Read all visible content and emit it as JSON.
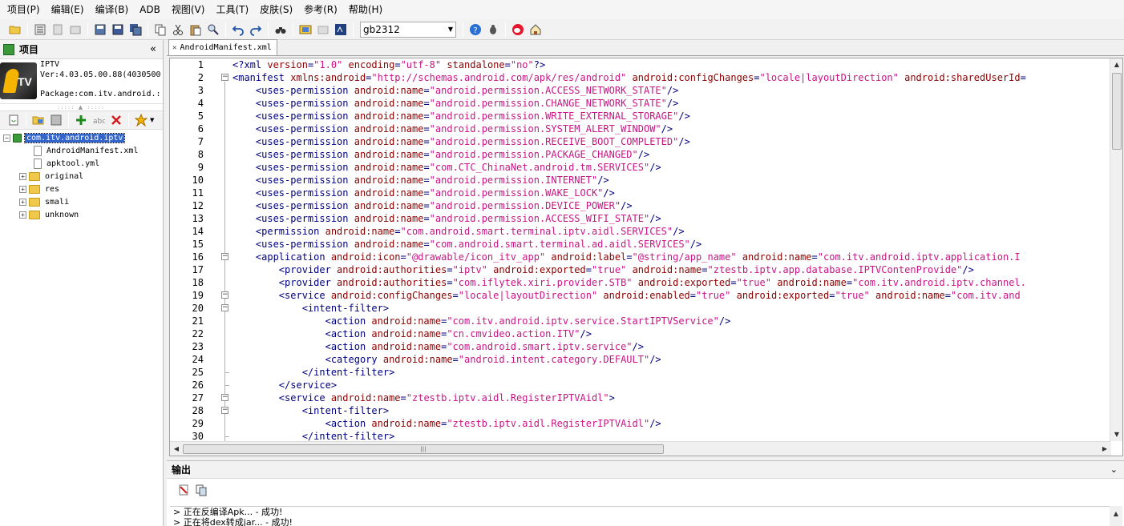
{
  "menu": [
    "项目(P)",
    "编辑(E)",
    "编译(B)",
    "ADB",
    "视图(V)",
    "工具(T)",
    "皮肤(S)",
    "参考(R)",
    "帮助(H)"
  ],
  "toolbar": {
    "encoding_value": "gb2312"
  },
  "project_panel": {
    "title": "项目",
    "collapse_glyph": "«",
    "app_name": "IPTV",
    "app_version": "Ver:4.03.05.00.88(4030500",
    "app_package": "Package:com.itv.android.:"
  },
  "tree": {
    "root": "com.itv.android.iptv",
    "files": [
      "AndroidManifest.xml",
      "apktool.yml"
    ],
    "folders": [
      "original",
      "res",
      "smali",
      "unknown"
    ]
  },
  "editor": {
    "tab_label": "AndroidManifest.xml",
    "line_numbers": [
      "1",
      "2",
      "3",
      "4",
      "5",
      "6",
      "7",
      "8",
      "9",
      "10",
      "11",
      "12",
      "13",
      "14",
      "15",
      "16",
      "17",
      "18",
      "19",
      "20",
      "21",
      "22",
      "23",
      "24",
      "25",
      "26",
      "27",
      "28",
      "29",
      "30"
    ],
    "lines": [
      [
        {
          "c": "p",
          "s": "<?xml "
        },
        {
          "c": "a",
          "s": "version"
        },
        {
          "c": "p",
          "s": "="
        },
        {
          "c": "v",
          "s": "\"1.0\""
        },
        {
          "c": "p",
          "s": " "
        },
        {
          "c": "a",
          "s": "encoding"
        },
        {
          "c": "p",
          "s": "="
        },
        {
          "c": "v",
          "s": "\"utf-8\""
        },
        {
          "c": "p",
          "s": " "
        },
        {
          "c": "a",
          "s": "standalone"
        },
        {
          "c": "p",
          "s": "="
        },
        {
          "c": "v",
          "s": "\"no\""
        },
        {
          "c": "p",
          "s": "?>"
        }
      ],
      [
        {
          "c": "t",
          "s": "<manifest "
        },
        {
          "c": "a",
          "s": "xmlns:android"
        },
        {
          "c": "p",
          "s": "="
        },
        {
          "c": "v",
          "s": "\"http://schemas.android.com/apk/res/android\""
        },
        {
          "c": "p",
          "s": " "
        },
        {
          "c": "a",
          "s": "android:configChanges"
        },
        {
          "c": "p",
          "s": "="
        },
        {
          "c": "v",
          "s": "\"locale|layoutDirection\""
        },
        {
          "c": "p",
          "s": " "
        },
        {
          "c": "a",
          "s": "android:sharedUserId"
        },
        {
          "c": "p",
          "s": "="
        }
      ],
      [
        {
          "c": "p",
          "s": "    "
        },
        {
          "c": "t",
          "s": "<uses-permission "
        },
        {
          "c": "a",
          "s": "android:name"
        },
        {
          "c": "p",
          "s": "="
        },
        {
          "c": "v",
          "s": "\"android.permission.ACCESS_NETWORK_STATE\""
        },
        {
          "c": "t",
          "s": "/>"
        }
      ],
      [
        {
          "c": "p",
          "s": "    "
        },
        {
          "c": "t",
          "s": "<uses-permission "
        },
        {
          "c": "a",
          "s": "android:name"
        },
        {
          "c": "p",
          "s": "="
        },
        {
          "c": "v",
          "s": "\"android.permission.CHANGE_NETWORK_STATE\""
        },
        {
          "c": "t",
          "s": "/>"
        }
      ],
      [
        {
          "c": "p",
          "s": "    "
        },
        {
          "c": "t",
          "s": "<uses-permission "
        },
        {
          "c": "a",
          "s": "android:name"
        },
        {
          "c": "p",
          "s": "="
        },
        {
          "c": "v",
          "s": "\"android.permission.WRITE_EXTERNAL_STORAGE\""
        },
        {
          "c": "t",
          "s": "/>"
        }
      ],
      [
        {
          "c": "p",
          "s": "    "
        },
        {
          "c": "t",
          "s": "<uses-permission "
        },
        {
          "c": "a",
          "s": "android:name"
        },
        {
          "c": "p",
          "s": "="
        },
        {
          "c": "v",
          "s": "\"android.permission.SYSTEM_ALERT_WINDOW\""
        },
        {
          "c": "t",
          "s": "/>"
        }
      ],
      [
        {
          "c": "p",
          "s": "    "
        },
        {
          "c": "t",
          "s": "<uses-permission "
        },
        {
          "c": "a",
          "s": "android:name"
        },
        {
          "c": "p",
          "s": "="
        },
        {
          "c": "v",
          "s": "\"android.permission.RECEIVE_BOOT_COMPLETED\""
        },
        {
          "c": "t",
          "s": "/>"
        }
      ],
      [
        {
          "c": "p",
          "s": "    "
        },
        {
          "c": "t",
          "s": "<uses-permission "
        },
        {
          "c": "a",
          "s": "android:name"
        },
        {
          "c": "p",
          "s": "="
        },
        {
          "c": "v",
          "s": "\"android.permission.PACKAGE_CHANGED\""
        },
        {
          "c": "t",
          "s": "/>"
        }
      ],
      [
        {
          "c": "p",
          "s": "    "
        },
        {
          "c": "t",
          "s": "<uses-permission "
        },
        {
          "c": "a",
          "s": "android:name"
        },
        {
          "c": "p",
          "s": "="
        },
        {
          "c": "v",
          "s": "\"com.CTC_ChinaNet.android.tm.SERVICES\""
        },
        {
          "c": "t",
          "s": "/>"
        }
      ],
      [
        {
          "c": "p",
          "s": "    "
        },
        {
          "c": "t",
          "s": "<uses-permission "
        },
        {
          "c": "a",
          "s": "android:name"
        },
        {
          "c": "p",
          "s": "="
        },
        {
          "c": "v",
          "s": "\"android.permission.INTERNET\""
        },
        {
          "c": "t",
          "s": "/>"
        }
      ],
      [
        {
          "c": "p",
          "s": "    "
        },
        {
          "c": "t",
          "s": "<uses-permission "
        },
        {
          "c": "a",
          "s": "android:name"
        },
        {
          "c": "p",
          "s": "="
        },
        {
          "c": "v",
          "s": "\"android.permission.WAKE_LOCK\""
        },
        {
          "c": "t",
          "s": "/>"
        }
      ],
      [
        {
          "c": "p",
          "s": "    "
        },
        {
          "c": "t",
          "s": "<uses-permission "
        },
        {
          "c": "a",
          "s": "android:name"
        },
        {
          "c": "p",
          "s": "="
        },
        {
          "c": "v",
          "s": "\"android.permission.DEVICE_POWER\""
        },
        {
          "c": "t",
          "s": "/>"
        }
      ],
      [
        {
          "c": "p",
          "s": "    "
        },
        {
          "c": "t",
          "s": "<uses-permission "
        },
        {
          "c": "a",
          "s": "android:name"
        },
        {
          "c": "p",
          "s": "="
        },
        {
          "c": "v",
          "s": "\"android.permission.ACCESS_WIFI_STATE\""
        },
        {
          "c": "t",
          "s": "/>"
        }
      ],
      [
        {
          "c": "p",
          "s": "    "
        },
        {
          "c": "t",
          "s": "<permission "
        },
        {
          "c": "a",
          "s": "android:name"
        },
        {
          "c": "p",
          "s": "="
        },
        {
          "c": "v",
          "s": "\"com.android.smart.terminal.iptv.aidl.SERVICES\""
        },
        {
          "c": "t",
          "s": "/>"
        }
      ],
      [
        {
          "c": "p",
          "s": "    "
        },
        {
          "c": "t",
          "s": "<uses-permission "
        },
        {
          "c": "a",
          "s": "android:name"
        },
        {
          "c": "p",
          "s": "="
        },
        {
          "c": "v",
          "s": "\"com.android.smart.terminal.ad.aidl.SERVICES\""
        },
        {
          "c": "t",
          "s": "/>"
        }
      ],
      [
        {
          "c": "p",
          "s": "    "
        },
        {
          "c": "t",
          "s": "<application "
        },
        {
          "c": "a",
          "s": "android:icon"
        },
        {
          "c": "p",
          "s": "="
        },
        {
          "c": "v",
          "s": "\"@drawable/icon_itv_app\""
        },
        {
          "c": "p",
          "s": " "
        },
        {
          "c": "a",
          "s": "android:label"
        },
        {
          "c": "p",
          "s": "="
        },
        {
          "c": "v",
          "s": "\"@string/app_name\""
        },
        {
          "c": "p",
          "s": " "
        },
        {
          "c": "a",
          "s": "android:name"
        },
        {
          "c": "p",
          "s": "="
        },
        {
          "c": "v",
          "s": "\"com.itv.android.iptv.application.I"
        }
      ],
      [
        {
          "c": "p",
          "s": "        "
        },
        {
          "c": "t",
          "s": "<provider "
        },
        {
          "c": "a",
          "s": "android:authorities"
        },
        {
          "c": "p",
          "s": "="
        },
        {
          "c": "v",
          "s": "\"iptv\""
        },
        {
          "c": "p",
          "s": " "
        },
        {
          "c": "a",
          "s": "android:exported"
        },
        {
          "c": "p",
          "s": "="
        },
        {
          "c": "v",
          "s": "\"true\""
        },
        {
          "c": "p",
          "s": " "
        },
        {
          "c": "a",
          "s": "android:name"
        },
        {
          "c": "p",
          "s": "="
        },
        {
          "c": "v",
          "s": "\"ztestb.iptv.app.database.IPTVContenProvide\""
        },
        {
          "c": "t",
          "s": "/>"
        }
      ],
      [
        {
          "c": "p",
          "s": "        "
        },
        {
          "c": "t",
          "s": "<provider "
        },
        {
          "c": "a",
          "s": "android:authorities"
        },
        {
          "c": "p",
          "s": "="
        },
        {
          "c": "v",
          "s": "\"com.iflytek.xiri.provider.STB\""
        },
        {
          "c": "p",
          "s": " "
        },
        {
          "c": "a",
          "s": "android:exported"
        },
        {
          "c": "p",
          "s": "="
        },
        {
          "c": "v",
          "s": "\"true\""
        },
        {
          "c": "p",
          "s": " "
        },
        {
          "c": "a",
          "s": "android:name"
        },
        {
          "c": "p",
          "s": "="
        },
        {
          "c": "v",
          "s": "\"com.itv.android.iptv.channel."
        }
      ],
      [
        {
          "c": "p",
          "s": "        "
        },
        {
          "c": "t",
          "s": "<service "
        },
        {
          "c": "a",
          "s": "android:configChanges"
        },
        {
          "c": "p",
          "s": "="
        },
        {
          "c": "v",
          "s": "\"locale|layoutDirection\""
        },
        {
          "c": "p",
          "s": " "
        },
        {
          "c": "a",
          "s": "android:enabled"
        },
        {
          "c": "p",
          "s": "="
        },
        {
          "c": "v",
          "s": "\"true\""
        },
        {
          "c": "p",
          "s": " "
        },
        {
          "c": "a",
          "s": "android:exported"
        },
        {
          "c": "p",
          "s": "="
        },
        {
          "c": "v",
          "s": "\"true\""
        },
        {
          "c": "p",
          "s": " "
        },
        {
          "c": "a",
          "s": "android:name"
        },
        {
          "c": "p",
          "s": "="
        },
        {
          "c": "v",
          "s": "\"com.itv.and"
        }
      ],
      [
        {
          "c": "p",
          "s": "            "
        },
        {
          "c": "t",
          "s": "<intent-filter>"
        }
      ],
      [
        {
          "c": "p",
          "s": "                "
        },
        {
          "c": "t",
          "s": "<action "
        },
        {
          "c": "a",
          "s": "android:name"
        },
        {
          "c": "p",
          "s": "="
        },
        {
          "c": "v",
          "s": "\"com.itv.android.iptv.service.StartIPTVService\""
        },
        {
          "c": "t",
          "s": "/>"
        }
      ],
      [
        {
          "c": "p",
          "s": "                "
        },
        {
          "c": "t",
          "s": "<action "
        },
        {
          "c": "a",
          "s": "android:name"
        },
        {
          "c": "p",
          "s": "="
        },
        {
          "c": "v",
          "s": "\"cn.cmvideo.action.ITV\""
        },
        {
          "c": "t",
          "s": "/>"
        }
      ],
      [
        {
          "c": "p",
          "s": "                "
        },
        {
          "c": "t",
          "s": "<action "
        },
        {
          "c": "a",
          "s": "android:name"
        },
        {
          "c": "p",
          "s": "="
        },
        {
          "c": "v",
          "s": "\"com.android.smart.iptv.service\""
        },
        {
          "c": "t",
          "s": "/>"
        }
      ],
      [
        {
          "c": "p",
          "s": "                "
        },
        {
          "c": "t",
          "s": "<category "
        },
        {
          "c": "a",
          "s": "android:name"
        },
        {
          "c": "p",
          "s": "="
        },
        {
          "c": "v",
          "s": "\"android.intent.category.DEFAULT\""
        },
        {
          "c": "t",
          "s": "/>"
        }
      ],
      [
        {
          "c": "p",
          "s": "            "
        },
        {
          "c": "t",
          "s": "</intent-filter>"
        }
      ],
      [
        {
          "c": "p",
          "s": "        "
        },
        {
          "c": "t",
          "s": "</service>"
        }
      ],
      [
        {
          "c": "p",
          "s": "        "
        },
        {
          "c": "t",
          "s": "<service "
        },
        {
          "c": "a",
          "s": "android:name"
        },
        {
          "c": "p",
          "s": "="
        },
        {
          "c": "v",
          "s": "\"ztestb.iptv.aidl.RegisterIPTVAidl\""
        },
        {
          "c": "t",
          "s": ">"
        }
      ],
      [
        {
          "c": "p",
          "s": "            "
        },
        {
          "c": "t",
          "s": "<intent-filter>"
        }
      ],
      [
        {
          "c": "p",
          "s": "                "
        },
        {
          "c": "t",
          "s": "<action "
        },
        {
          "c": "a",
          "s": "android:name"
        },
        {
          "c": "p",
          "s": "="
        },
        {
          "c": "v",
          "s": "\"ztestb.iptv.aidl.RegisterIPTVAidl\""
        },
        {
          "c": "t",
          "s": "/>"
        }
      ],
      [
        {
          "c": "p",
          "s": "            "
        },
        {
          "c": "t",
          "s": "</intent-filter>"
        }
      ]
    ]
  },
  "output_panel": {
    "title": "输出",
    "collapse_glyph": "⌄",
    "log": [
      "> 正在反编译Apk...  - 成功!",
      "> 正在将dex转成jar...  - 成功!"
    ]
  },
  "colors": {
    "tag": "#000080",
    "attr": "#8b0000",
    "value": "#c71585",
    "selection": "#3366cc"
  }
}
